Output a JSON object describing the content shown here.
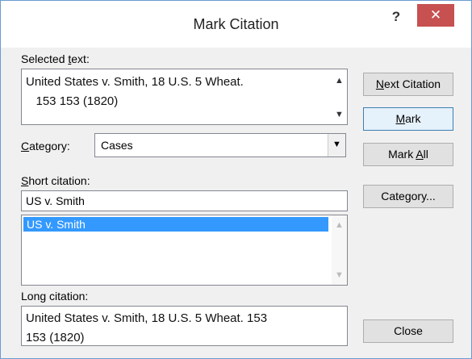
{
  "window": {
    "title": "Mark Citation",
    "help_glyph": "?",
    "close_glyph": "✕"
  },
  "selected_text": {
    "label_pre": "Selected ",
    "label_key": "t",
    "label_post": "ext:",
    "line1": "United States v. Smith, 18 U.S. 5 Wheat.",
    "line2": "   153 153 (1820)"
  },
  "category": {
    "label_key": "C",
    "label_post": "ategory:",
    "value": "Cases"
  },
  "short_citation": {
    "label_key": "S",
    "label_post": "hort citation:",
    "input_value": "US v. Smith",
    "list_items": [
      "US v. Smith"
    ]
  },
  "long_citation": {
    "label": "Long citation:",
    "line1": "United States v. Smith, 18 U.S. 5 Wheat. 153",
    "line2": "153 (1820)"
  },
  "buttons": {
    "next_citation_key": "N",
    "next_citation_post": "ext Citation",
    "mark_key": "M",
    "mark_post": "ark",
    "mark_all_pre": "Mark ",
    "mark_all_key": "A",
    "mark_all_post": "ll",
    "category_pre": "Cate",
    "category_key": "g",
    "category_post": "ory...",
    "close": "Close"
  },
  "icons": {
    "scroll_up": "▲",
    "scroll_down": "▼",
    "dropdown": "▼"
  }
}
